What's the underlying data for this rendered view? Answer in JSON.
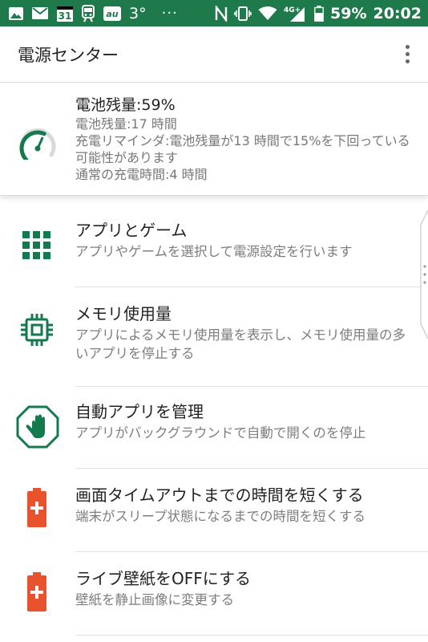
{
  "status_bar": {
    "temperature": "3°",
    "more": "···",
    "network": "4G+",
    "battery_percent": "59%",
    "time": "20:02",
    "calendar_day": "31",
    "au_label": "au"
  },
  "app_bar": {
    "title": "電源センター"
  },
  "battery": {
    "title": "電池残量:59%",
    "remaining": "電池残量:17 時間",
    "reminder": "充電リマインダ:電池残量が13 時間で15%を下回っている可能性があります",
    "charge_time": "通常の充電時間:4 時間",
    "level": 0.59
  },
  "items": [
    {
      "title": "アプリとゲーム",
      "subtitle": "アプリやゲームを選択して電源設定を行います"
    },
    {
      "title": "メモリ使用量",
      "subtitle": "アプリによるメモリ使用量を表示し、メモリ使用量の多いアプリを停止する"
    },
    {
      "title": "自動アプリを管理",
      "subtitle": "アプリがバックグラウンドで自動で開くのを停止"
    },
    {
      "title": "画面タイムアウトまでの時間を短くする",
      "subtitle": "端末がスリープ状態になるまでの時間を短くする"
    },
    {
      "title": "ライブ壁紙をOFFにする",
      "subtitle": "壁紙を静止画像に変更する"
    }
  ],
  "colors": {
    "status_bar": "#1e7a4a",
    "accent_green": "#137a4e",
    "battery_orange": "#e8522c"
  }
}
